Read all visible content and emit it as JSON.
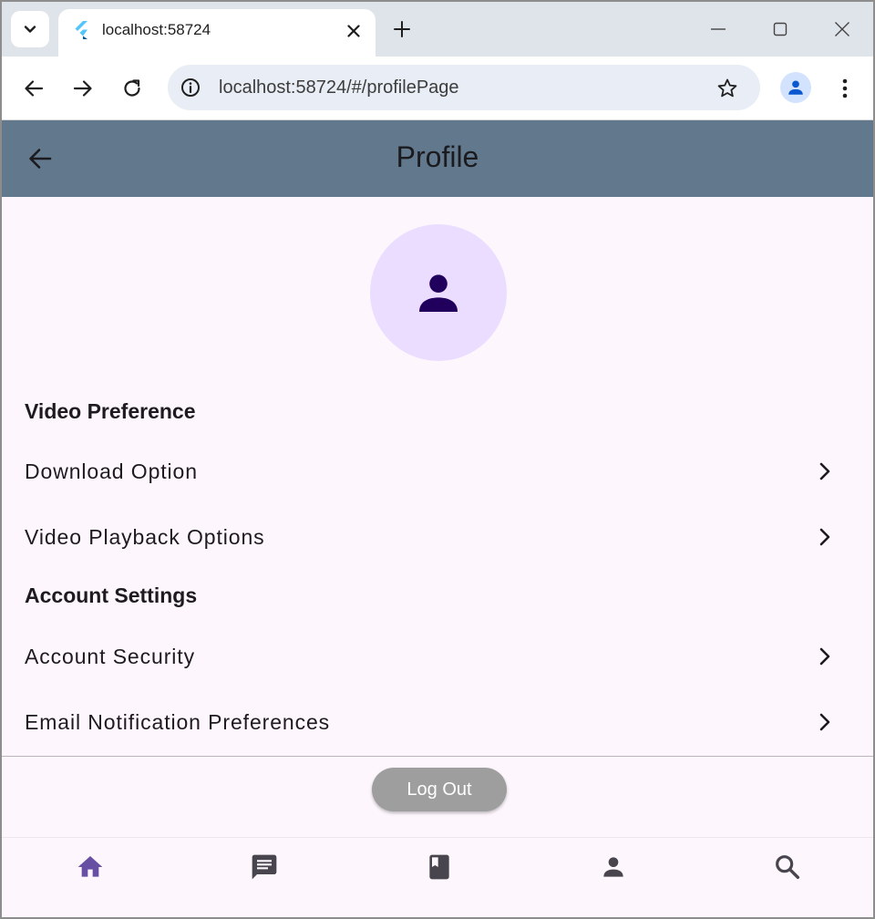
{
  "browser": {
    "tab_title": "localhost:58724",
    "url": "localhost:58724/#/profilePage",
    "icons": {
      "tab_search": "chevron-down-icon",
      "favicon": "flutter-icon",
      "close_tab": "close-icon",
      "new_tab": "plus-icon",
      "minimize": "minimize-icon",
      "maximize": "maximize-icon",
      "close_window": "close-icon",
      "back": "arrow-left-icon",
      "forward": "arrow-right-icon",
      "reload": "reload-icon",
      "site_info": "info-icon",
      "bookmark": "star-icon",
      "profile": "person-icon",
      "menu": "more-vert-icon"
    }
  },
  "appbar": {
    "title": "Profile",
    "back_icon": "arrow-back-icon",
    "background": "#62788c"
  },
  "profile": {
    "avatar_icon": "person-icon",
    "avatar_bg": "#eaddff",
    "avatar_fg": "#21005d"
  },
  "sections": [
    {
      "title": "Video Preference",
      "items": [
        {
          "label": "Download Option"
        },
        {
          "label": "Video Playback Options"
        }
      ]
    },
    {
      "title": "Account Settings",
      "items": [
        {
          "label": "Account Security"
        },
        {
          "label": "Email Notification Preferences"
        }
      ]
    }
  ],
  "logout": {
    "label": "Log Out",
    "background": "#9e9e9e"
  },
  "bottom_nav": {
    "items": [
      {
        "icon": "home-icon",
        "active": true
      },
      {
        "icon": "chat-icon",
        "active": false
      },
      {
        "icon": "book-icon",
        "active": false
      },
      {
        "icon": "person-icon",
        "active": false
      },
      {
        "icon": "search-icon",
        "active": false
      }
    ],
    "active_color": "#6750a4",
    "inactive_color": "#49454f"
  }
}
